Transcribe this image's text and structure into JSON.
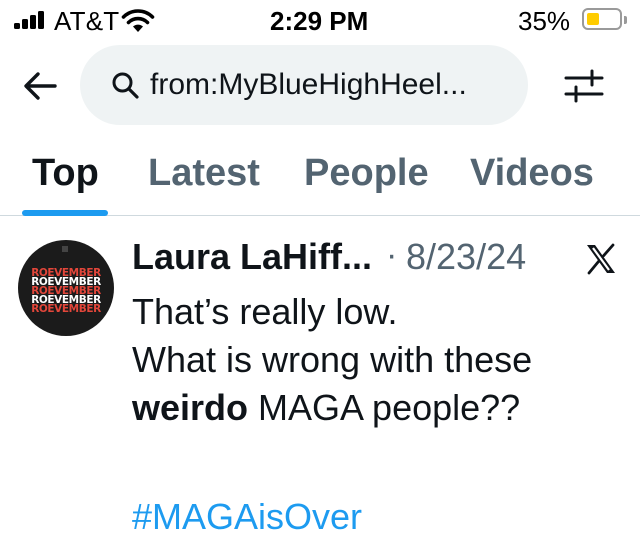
{
  "status_bar": {
    "carrier": "AT&T",
    "time": "2:29 PM",
    "battery_percent": "35%",
    "battery_level": 0.35,
    "battery_color": "#ffcc00"
  },
  "search": {
    "query": "from:MyBlueHighHeel..."
  },
  "tabs": [
    {
      "label": "Top",
      "active": true
    },
    {
      "label": "Latest",
      "active": false
    },
    {
      "label": "People",
      "active": false
    },
    {
      "label": "Videos",
      "active": false
    }
  ],
  "tweet": {
    "author": "Laura LaHiff...",
    "separator": "·",
    "date": "8/23/24",
    "avatar_text": [
      "ROEVEMBER",
      "ROEVEMBER",
      "ROEVEMBER",
      "ROEVEMBER",
      "ROEVEMBER"
    ],
    "body_line1": "That’s really low.",
    "body_line2": "What is wrong with these",
    "body_line3_bold": "weirdo",
    "body_line3_rest": " MAGA people??",
    "hashtag": "#MAGAisOver"
  },
  "colors": {
    "accent": "#1d9bf0",
    "muted_text": "#536471",
    "search_bg": "#eff3f4"
  }
}
